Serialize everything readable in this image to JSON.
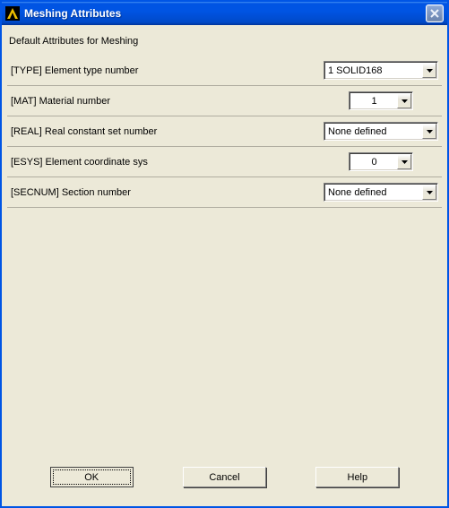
{
  "window": {
    "title": "Meshing Attributes"
  },
  "subtitle": "Default Attributes for Meshing",
  "fields": {
    "type": {
      "label": "[TYPE]  Element type number",
      "value": "1    SOLID168"
    },
    "mat": {
      "label": "[MAT]  Material number",
      "value": "1"
    },
    "real": {
      "label": "[REAL]  Real constant set number",
      "value": "None defined"
    },
    "esys": {
      "label": "[ESYS]  Element coordinate sys",
      "value": "0"
    },
    "secnum": {
      "label": "[SECNUM]  Section number",
      "value": "None defined"
    }
  },
  "buttons": {
    "ok": "OK",
    "cancel": "Cancel",
    "help": "Help"
  }
}
